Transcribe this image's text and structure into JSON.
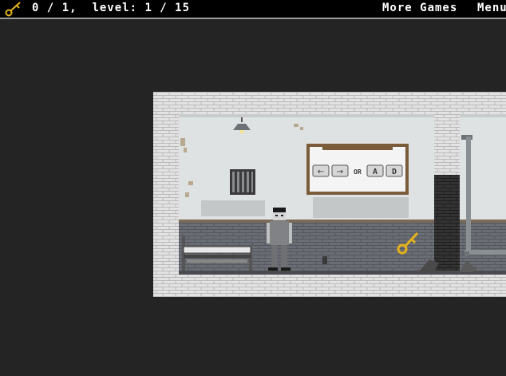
{
  "hud": {
    "keys_label": "0 / 1,",
    "level_label": "level: 1 / 15",
    "more_games": "More Games",
    "menu": "Menu"
  },
  "tutorial": {
    "key_left": "←",
    "key_right": "→",
    "or_label": "OR",
    "key_a": "A",
    "key_d": "D"
  },
  "icons": [
    "key-icon",
    "lamp-icon",
    "vent-icon",
    "bed-icon",
    "player-icon",
    "pipe-icon"
  ],
  "colors": {
    "background": "#242424",
    "hud": "#000000",
    "key": "#e5b21c",
    "wall": "#dfe2e3",
    "brick": "#5a5d63"
  }
}
